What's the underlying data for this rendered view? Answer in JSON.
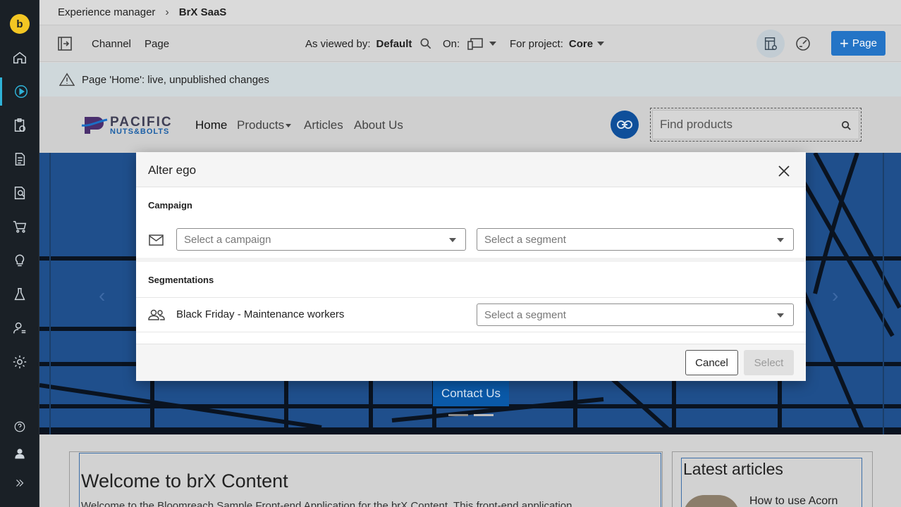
{
  "breadcrumb": {
    "parent": "Experience manager",
    "current": "BrX SaaS"
  },
  "rail": {
    "logo": "b"
  },
  "toolbar": {
    "channel_label": "Channel",
    "page_label": "Page",
    "viewed_by_label": "As viewed by:",
    "viewed_by_value": "Default",
    "on_label": "On:",
    "project_label": "For project:",
    "project_value": "Core",
    "add_page_label": "Page"
  },
  "status": {
    "message": "Page 'Home': live, unpublished changes"
  },
  "site": {
    "logo_top": "PACIFIC",
    "logo_bottom": "NUTS&BOLTS",
    "nav": [
      "Home",
      "Products",
      "Articles",
      "About Us"
    ],
    "search_placeholder": "Find products",
    "cta": "Contact Us",
    "welcome_title": "Welcome to brX Content",
    "welcome_text": "Welcome to the Bloomreach Sample Front-end Application for the brX Content. This front-end application",
    "sidebar_title": "Latest articles",
    "article_title": "How to use Acorn"
  },
  "modal": {
    "title": "Alter ego",
    "campaign_heading": "Campaign",
    "campaign_placeholder": "Select a campaign",
    "segment_placeholder": "Select a segment",
    "segmentations_heading": "Segmentations",
    "segmentation_name": "Black Friday - Maintenance workers",
    "cancel_label": "Cancel",
    "select_label": "Select"
  },
  "colors": {
    "accent": "#1b6fc6",
    "rail_bg": "#1a2026",
    "rail_active": "#2fb3d8"
  }
}
